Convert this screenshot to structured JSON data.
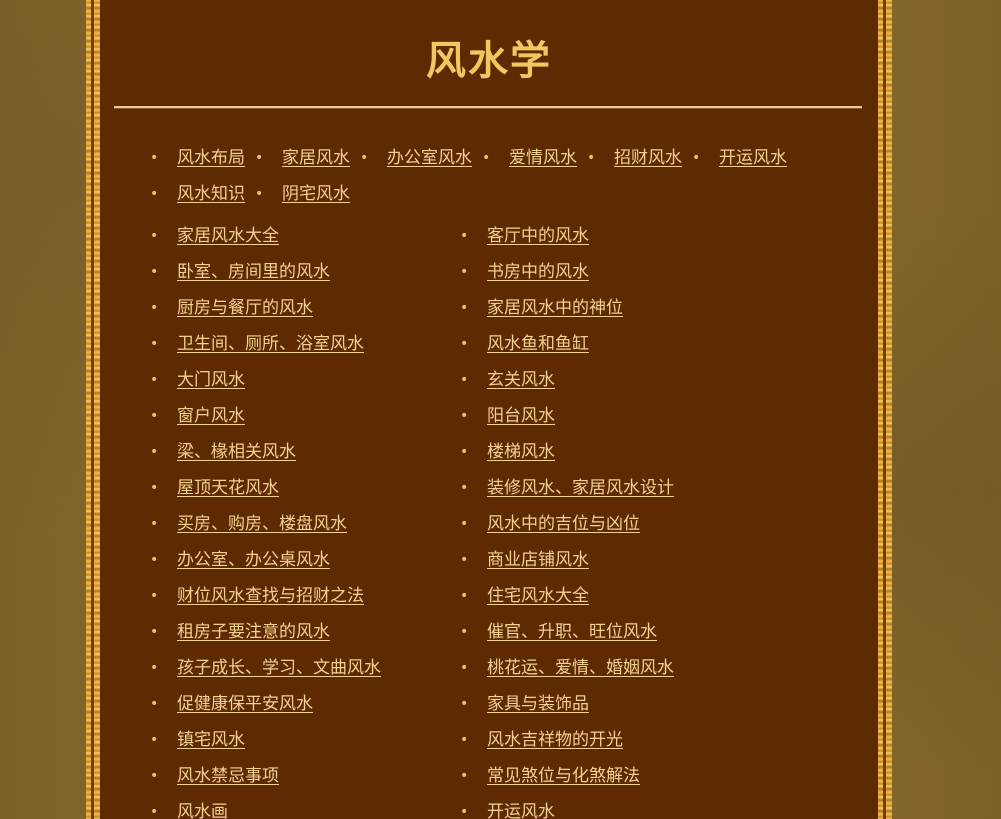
{
  "page": {
    "title": "风水学"
  },
  "top_nav": {
    "row1": [
      "风水布局",
      "家居风水",
      "办公室风水",
      "爱情风水",
      "招财风水",
      "开运风水"
    ],
    "row2": [
      "风水知识",
      "阴宅风水"
    ]
  },
  "links": {
    "left": [
      "家居风水大全",
      "卧室、房间里的风水",
      "厨房与餐厅的风水",
      "卫生间、厕所、浴室风水",
      "大门风水",
      "窗户风水",
      "梁、椽相关风水",
      "屋顶天花风水",
      "买房、购房、楼盘风水",
      "办公室、办公桌风水",
      "财位风水查找与招财之法",
      "租房子要注意的风水",
      "孩子成长、学习、文曲风水",
      "促健康保平安风水",
      "镇宅风水",
      "风水禁忌事项",
      "风水画"
    ],
    "right": [
      "客厅中的风水",
      "书房中的风水",
      "家居风水中的神位",
      "风水鱼和鱼缸",
      "玄关风水",
      "阳台风水",
      "楼梯风水",
      "装修风水、家居风水设计",
      "风水中的吉位与凶位",
      "商业店铺风水",
      "住宅风水大全",
      "催官、升职、旺位风水",
      "桃花运、爱情、婚姻风水",
      "家具与装饰品",
      "风水吉祥物的开光",
      "常见煞位与化煞解法",
      "开运风水"
    ]
  },
  "bullet_glyph": "•",
  "colors": {
    "panel": "#5e2a02",
    "title": "#f4c660",
    "link": "#f4d190",
    "border_gold": "#f2c050"
  }
}
